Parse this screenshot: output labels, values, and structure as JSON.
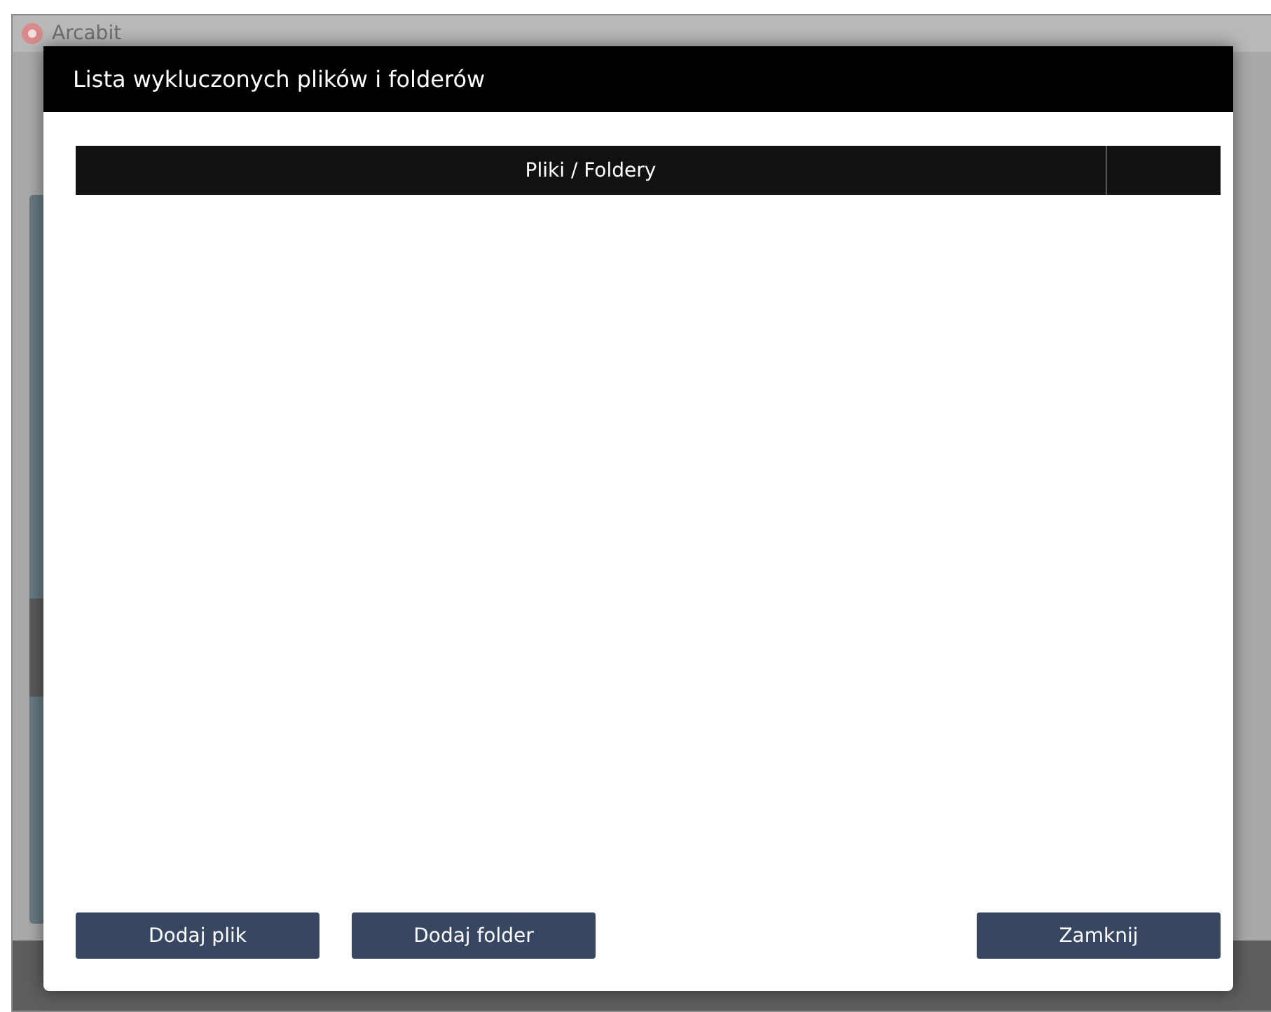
{
  "background_window": {
    "title": "Arcabit"
  },
  "dialog": {
    "title": "Lista wykluczonych plików i folderów",
    "table": {
      "columns": [
        "Pliki / Foldery"
      ]
    },
    "buttons_left": [
      "Dodaj plik",
      "Dodaj folder"
    ],
    "buttons_right": [
      "Zamknij"
    ]
  }
}
